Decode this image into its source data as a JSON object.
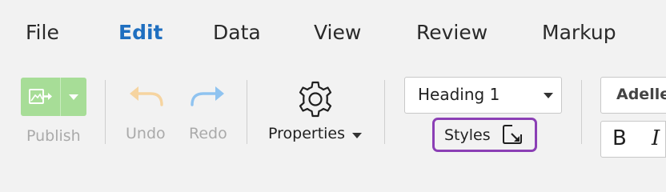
{
  "menu": {
    "items": [
      {
        "label": "File"
      },
      {
        "label": "Edit",
        "active": true
      },
      {
        "label": "Data"
      },
      {
        "label": "View"
      },
      {
        "label": "Review"
      },
      {
        "label": "Markup"
      }
    ]
  },
  "ribbon": {
    "publish": {
      "label": "Publish",
      "icon": "publish-icon"
    },
    "undo": {
      "label": "Undo",
      "icon": "undo-arrow-icon"
    },
    "redo": {
      "label": "Redo",
      "icon": "redo-arrow-icon"
    },
    "properties": {
      "label": "Properties",
      "icon": "gear-icon"
    },
    "paragraph_style": {
      "value": "Heading 1"
    },
    "styles": {
      "label": "Styles",
      "icon": "dialog-launcher-icon"
    },
    "font": {
      "value": "Adelle"
    },
    "format": {
      "bold": "B",
      "italic": "I"
    }
  },
  "colors": {
    "accent": "#1f6fc0",
    "publish_green": "#a7dd97",
    "undo_orange": "#f6d4a0",
    "redo_blue": "#8fc3f0",
    "highlight_purple": "#8b3fb5",
    "background": "#f2f2f2"
  }
}
